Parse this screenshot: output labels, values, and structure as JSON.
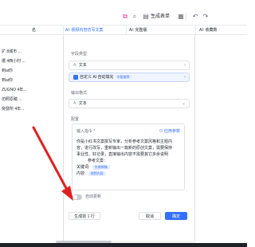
{
  "toolbar": {
    "generate_label": "生成表单",
    "icons": [
      "copy-icon",
      "search-icon",
      "form-icon",
      "undo-icon",
      "redo-icon",
      "more-icon"
    ]
  },
  "table": {
    "col_left_partial": "名",
    "col_prompt": "AI: 视频内容仿写文案",
    "col_complete": "AI: 完整版",
    "col_saved": "AI: 收藏数",
    "rows": [
      "扩 8城市 ...",
      "遭 4西小村 ...",
      "到ai你",
      "到ai你",
      "ZUGNO 4年...",
      "仿照原稿 ...",
      "突發所 4年..."
    ]
  },
  "dialog": {
    "field_type_label": "字段类型",
    "field_type_value": "文本",
    "recommend_label": "自定义 AI 自动填充",
    "recommend_badge": "字段推荐",
    "output_format_label": "输出格式",
    "output_format_value": "文本",
    "config_label": "配置",
    "prompt_title": "输入指令 *",
    "prompt_link": "⊙ 应用参数",
    "prompt_lines": [
      "你是小红书文案撰写专家，分析参考文案风格和主题内",
      "容，进行改写，重新输出一篇新的原创文案，需要保持",
      "事业性、好记录，直接输出内容不需要其它多余说明",
      "参考文案："
    ],
    "keyword_label": "关键词:",
    "keyword_chip": "先做原稿",
    "content_label": "内容:",
    "content_chip": "视频内容",
    "auto_update_label": "自动更新",
    "generate_rows_button": "生成前 1 行",
    "cancel_button": "取消",
    "confirm_button": "确定"
  },
  "colors": {
    "accent": "#3370ff",
    "annotation": "#e02020"
  }
}
